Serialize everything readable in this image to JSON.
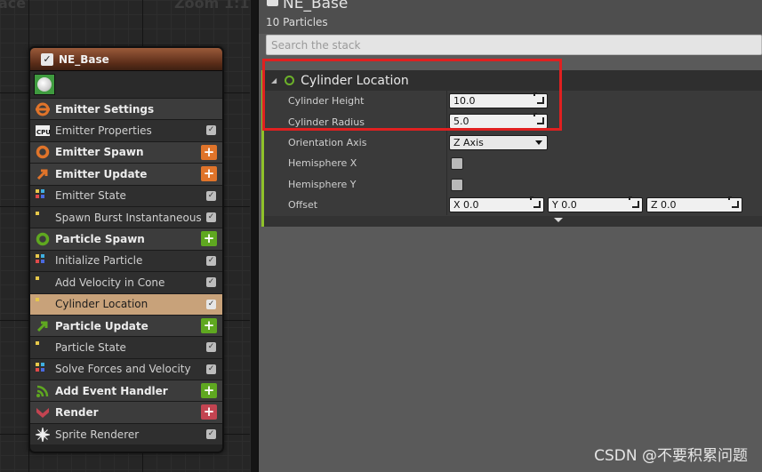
{
  "graph": {
    "zoom_text": "Zoom 1:1",
    "corner_text": "ace"
  },
  "node": {
    "title": "NE_Base",
    "rows": [
      {
        "kind": "section",
        "label": "Emitter Settings",
        "icon": "emitter-settings-icon",
        "color": "#e0742a"
      },
      {
        "kind": "module",
        "label": "Emitter Properties",
        "icon": "cpu-icon"
      },
      {
        "kind": "section",
        "label": "Emitter Spawn",
        "icon": "emitter-spawn-icon",
        "color": "#e0742a",
        "add": "orange"
      },
      {
        "kind": "section",
        "label": "Emitter Update",
        "icon": "emitter-update-icon",
        "color": "#e0742a",
        "add": "orange"
      },
      {
        "kind": "module",
        "label": "Emitter State",
        "icon": "module-dots-icon"
      },
      {
        "kind": "module",
        "label": "Spawn Burst Instantaneous",
        "icon": "module-dot-icon"
      },
      {
        "kind": "section",
        "label": "Particle Spawn",
        "icon": "particle-spawn-icon",
        "color": "#5fa820",
        "add": "green"
      },
      {
        "kind": "module",
        "label": "Initialize Particle",
        "icon": "module-dots-icon"
      },
      {
        "kind": "module",
        "label": "Add Velocity in Cone",
        "icon": "module-dot-icon"
      },
      {
        "kind": "module",
        "label": "Cylinder Location",
        "icon": "module-dot-icon",
        "selected": true
      },
      {
        "kind": "section",
        "label": "Particle Update",
        "icon": "particle-update-icon",
        "color": "#5fa820",
        "add": "green"
      },
      {
        "kind": "module",
        "label": "Particle State",
        "icon": "module-dot-icon"
      },
      {
        "kind": "module",
        "label": "Solve Forces and Velocity",
        "icon": "module-dots-icon"
      },
      {
        "kind": "section",
        "label": "Add Event Handler",
        "icon": "event-handler-icon",
        "color": "#5fa820",
        "add": "green"
      },
      {
        "kind": "section",
        "label": "Render",
        "icon": "render-icon",
        "color": "#c34451",
        "add": "red"
      },
      {
        "kind": "module",
        "label": "Sprite Renderer",
        "icon": "sprite-icon"
      }
    ]
  },
  "panel": {
    "emitter_name": "NE_Base",
    "particle_count": "10 Particles",
    "search_placeholder": "Search the stack",
    "module_title": "Cylinder Location",
    "params": {
      "cylinder_height": {
        "label": "Cylinder Height",
        "value": "10.0"
      },
      "cylinder_radius": {
        "label": "Cylinder Radius",
        "value": "5.0"
      },
      "orientation_axis": {
        "label": "Orientation Axis",
        "value": "Z Axis"
      },
      "hemisphere_x": {
        "label": "Hemisphere X",
        "checked": false
      },
      "hemisphere_y": {
        "label": "Hemisphere Y",
        "checked": false
      },
      "offset": {
        "label": "Offset",
        "x": "X 0.0",
        "y": "Y 0.0",
        "z": "Z 0.0"
      }
    }
  },
  "watermark": "CSDN @不要积累问题"
}
